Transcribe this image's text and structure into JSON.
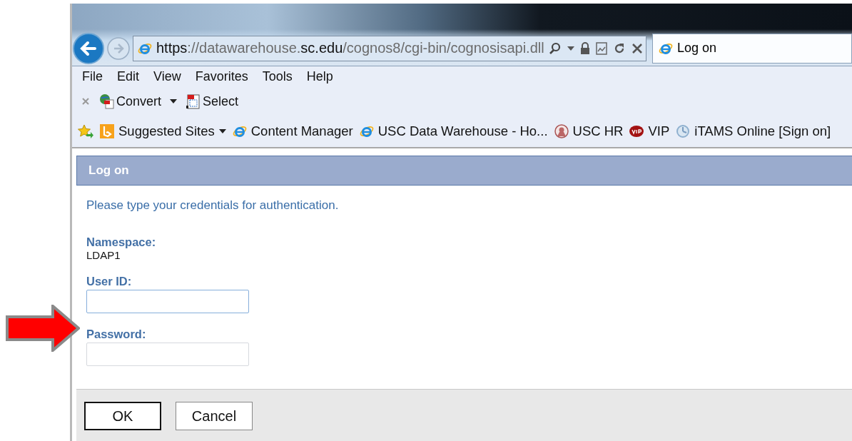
{
  "browser": {
    "address_bar": {
      "url": [
        {
          "text": "https",
          "strong": true
        },
        {
          "text": "://datawarehouse.",
          "strong": false
        },
        {
          "text": "sc.edu",
          "strong": true
        },
        {
          "text": "/cognos8/cgi-bin/cognosisapi.dll",
          "strong": false
        }
      ]
    },
    "tab": {
      "title": "Log on",
      "selected": true
    },
    "menu": [
      "File",
      "Edit",
      "View",
      "Favorites",
      "Tools",
      "Help"
    ],
    "command_bar": [
      {
        "label": "Convert",
        "kind": "convert",
        "dropdown": true
      },
      {
        "label": "Select",
        "kind": "select",
        "dropdown": false
      }
    ],
    "favorites": [
      {
        "label": "Suggested Sites",
        "kind": "bing",
        "dropdown": true
      },
      {
        "label": "Content Manager",
        "kind": "ie",
        "dropdown": false
      },
      {
        "label": "USC Data Warehouse - Ho...",
        "kind": "ie",
        "dropdown": false
      },
      {
        "label": "USC HR",
        "kind": "seal",
        "dropdown": false
      },
      {
        "label": "VIP",
        "kind": "vip",
        "dropdown": false
      },
      {
        "label": "iTAMS Online [Sign on]",
        "kind": "itams",
        "dropdown": false
      }
    ]
  },
  "dialog": {
    "title": "Log on",
    "instructions": "Please type your credentials for authentication.",
    "namespace": {
      "label": "Namespace:",
      "value": "LDAP1"
    },
    "fields": [
      {
        "label": "User ID:",
        "focused": true
      },
      {
        "label": "Password:",
        "focused": false
      }
    ],
    "buttons": [
      {
        "label": "OK",
        "default": true
      },
      {
        "label": "Cancel",
        "default": false
      }
    ]
  }
}
